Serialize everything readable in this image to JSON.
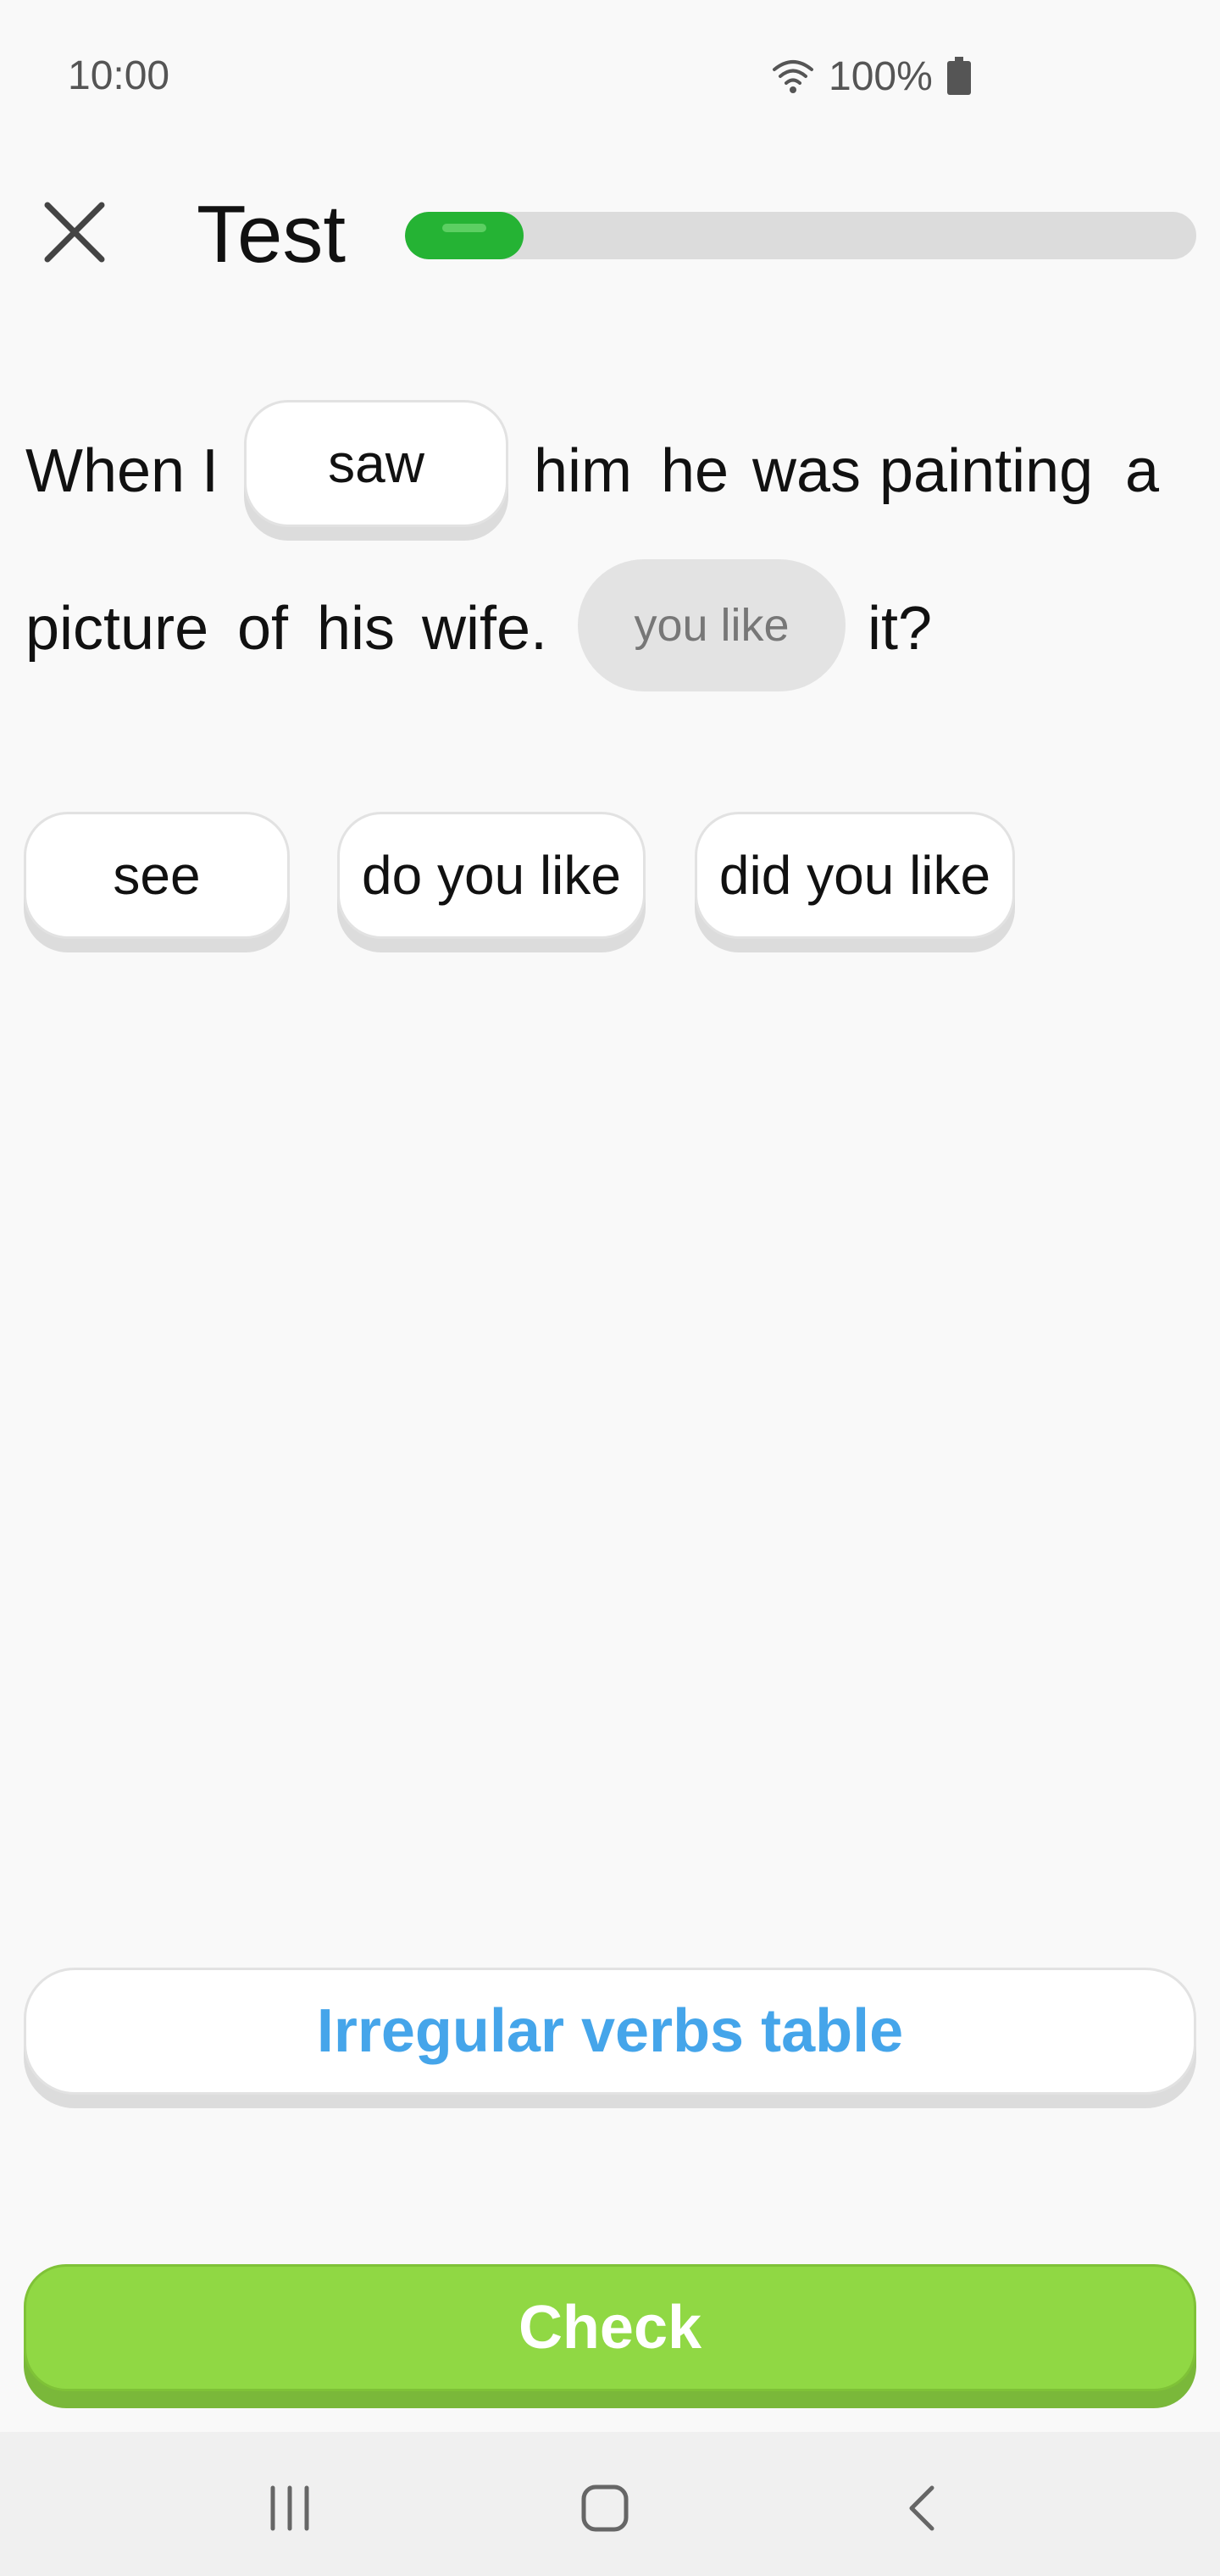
{
  "status_bar": {
    "time": "10:00",
    "battery_percent": "100%",
    "icons": [
      "wifi-icon",
      "battery-icon"
    ]
  },
  "header": {
    "close_icon": "close-icon",
    "title": "Test",
    "progress_fraction": 0.15
  },
  "sentence": {
    "line1_before": [
      "When",
      "I"
    ],
    "filled_answer": "saw",
    "line1_after": [
      "him",
      "he",
      "was",
      "painting",
      "a"
    ],
    "line2_before": [
      "picture",
      "of",
      "his",
      "wife."
    ],
    "empty_slot_placeholder": "you like",
    "line2_after": [
      "it?"
    ]
  },
  "options": [
    "see",
    "do you like",
    "did you like"
  ],
  "buttons": {
    "irregular_verbs": "Irregular verbs table",
    "check": "Check"
  },
  "colors": {
    "progress": "#25b334",
    "check": "#90d844",
    "link": "#45a5ea"
  },
  "nav_bar": {
    "icons": [
      "recent-apps-icon",
      "home-icon",
      "back-icon"
    ]
  }
}
